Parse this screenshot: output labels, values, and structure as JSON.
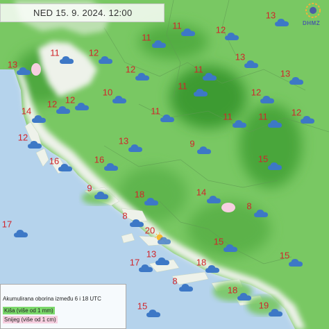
{
  "header": {
    "date_time": "NED  15. 9. 2024. 12:00"
  },
  "logo": {
    "text": "DHMZ",
    "icon": "dhmz-logo-icon"
  },
  "legend": {
    "title": "Akumulirana oborina između 6 i 18 UTC",
    "rain_label": "Kiša (više od 1 mm)",
    "snow_label": "Snijeg (više od 1 cm)",
    "rain_color": "#7bd86b",
    "snow_color": "#f6cfe0"
  },
  "colors": {
    "land_green": "#79c863",
    "dark_green": "#4aa53a",
    "sea": "#b5d3ec",
    "no_precip_land": "#eef2ea",
    "temperature": "#d0262b",
    "cloud": "#3d78c6"
  },
  "stations": [
    {
      "temp": "13",
      "icon": "cloud-icon"
    },
    {
      "temp": "11",
      "icon": "cloud-icon"
    },
    {
      "temp": "12",
      "icon": "cloud-icon"
    },
    {
      "temp": "11",
      "icon": "cloud-icon"
    },
    {
      "temp": "13",
      "icon": "cloud-icon"
    },
    {
      "temp": "11",
      "icon": "cloud-icon"
    },
    {
      "temp": "12",
      "icon": "cloud-icon"
    },
    {
      "temp": "13",
      "icon": "cloud-icon"
    },
    {
      "temp": "11",
      "icon": "cloud-icon"
    },
    {
      "temp": "12",
      "icon": "cloud-icon"
    },
    {
      "temp": "13",
      "icon": "cloud-icon"
    },
    {
      "temp": "11",
      "icon": "cloud-icon"
    },
    {
      "temp": "10",
      "icon": "cloud-icon"
    },
    {
      "temp": "12",
      "icon": "cloud-icon"
    },
    {
      "temp": "12",
      "icon": "cloud-icon"
    },
    {
      "temp": "12",
      "icon": "cloud-icon"
    },
    {
      "temp": "12",
      "icon": "cloud-icon"
    },
    {
      "temp": "14",
      "icon": "cloud-icon"
    },
    {
      "temp": "11",
      "icon": "cloud-icon"
    },
    {
      "temp": "11",
      "icon": "cloud-icon"
    },
    {
      "temp": "11",
      "icon": "cloud-icon"
    },
    {
      "temp": "12",
      "icon": "cloud-icon"
    },
    {
      "temp": "16",
      "icon": "cloud-icon"
    },
    {
      "temp": "13",
      "icon": "cloud-icon"
    },
    {
      "temp": "9",
      "icon": "cloud-icon"
    },
    {
      "temp": "16",
      "icon": "cloud-icon"
    },
    {
      "temp": "15",
      "icon": "cloud-icon"
    },
    {
      "temp": "9",
      "icon": "cloud-icon"
    },
    {
      "temp": "18",
      "icon": "cloud-icon"
    },
    {
      "temp": "14",
      "icon": "cloud-icon"
    },
    {
      "temp": "8",
      "icon": "cloud-icon"
    },
    {
      "temp": "8",
      "icon": "cloud-icon"
    },
    {
      "temp": "17",
      "icon": "cloud-icon"
    },
    {
      "temp": "20",
      "icon": "sun-cloud-icon"
    },
    {
      "temp": "15",
      "icon": "cloud-icon"
    },
    {
      "temp": "13",
      "icon": "cloud-icon"
    },
    {
      "temp": "17",
      "icon": "cloud-icon"
    },
    {
      "temp": "18",
      "icon": "cloud-icon"
    },
    {
      "temp": "15",
      "icon": "cloud-icon"
    },
    {
      "temp": "8",
      "icon": "cloud-icon"
    },
    {
      "temp": "18",
      "icon": "cloud-icon"
    },
    {
      "temp": "15",
      "icon": "cloud-icon"
    },
    {
      "temp": "19",
      "icon": "cloud-icon"
    },
    {
      "temp": "15",
      "icon": "cloud-icon"
    }
  ]
}
